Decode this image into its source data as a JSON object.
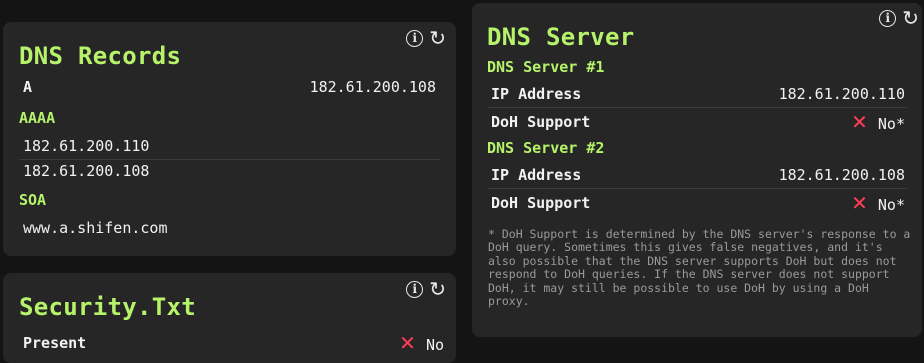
{
  "dns_records": {
    "title": "DNS Records",
    "a_label": "A",
    "a_value": "182.61.200.108",
    "aaaa_label": "AAAA",
    "aaaa_values": [
      "182.61.200.110",
      "182.61.200.108"
    ],
    "soa_label": "SOA",
    "soa_value": "www.a.shifen.com"
  },
  "security_txt": {
    "title": "Security.Txt",
    "present_label": "Present",
    "present_value": "No"
  },
  "dns_server": {
    "title": "DNS Server",
    "servers": [
      {
        "heading": "DNS Server #1",
        "ip_label": "IP Address",
        "ip_value": "182.61.200.110",
        "doh_label": "DoH Support",
        "doh_value": "No*"
      },
      {
        "heading": "DNS Server #2",
        "ip_label": "IP Address",
        "ip_value": "182.61.200.108",
        "doh_label": "DoH Support",
        "doh_value": "No*"
      }
    ],
    "note": "* DoH Support is determined by the DNS server's response to a DoH query. Sometimes this gives false negatives, and it's also possible that the DNS server supports DoH but does not respond to DoH queries. If the DNS server does not support DoH, it may still be possible to use DoH by using a DoH proxy."
  },
  "icons": {
    "info": "info-icon",
    "refresh": "refresh-icon",
    "cross": "cross-icon"
  },
  "colors": {
    "accent": "#b6f36b",
    "card": "#262626",
    "background": "#141414",
    "danger": "#ff3d57"
  }
}
